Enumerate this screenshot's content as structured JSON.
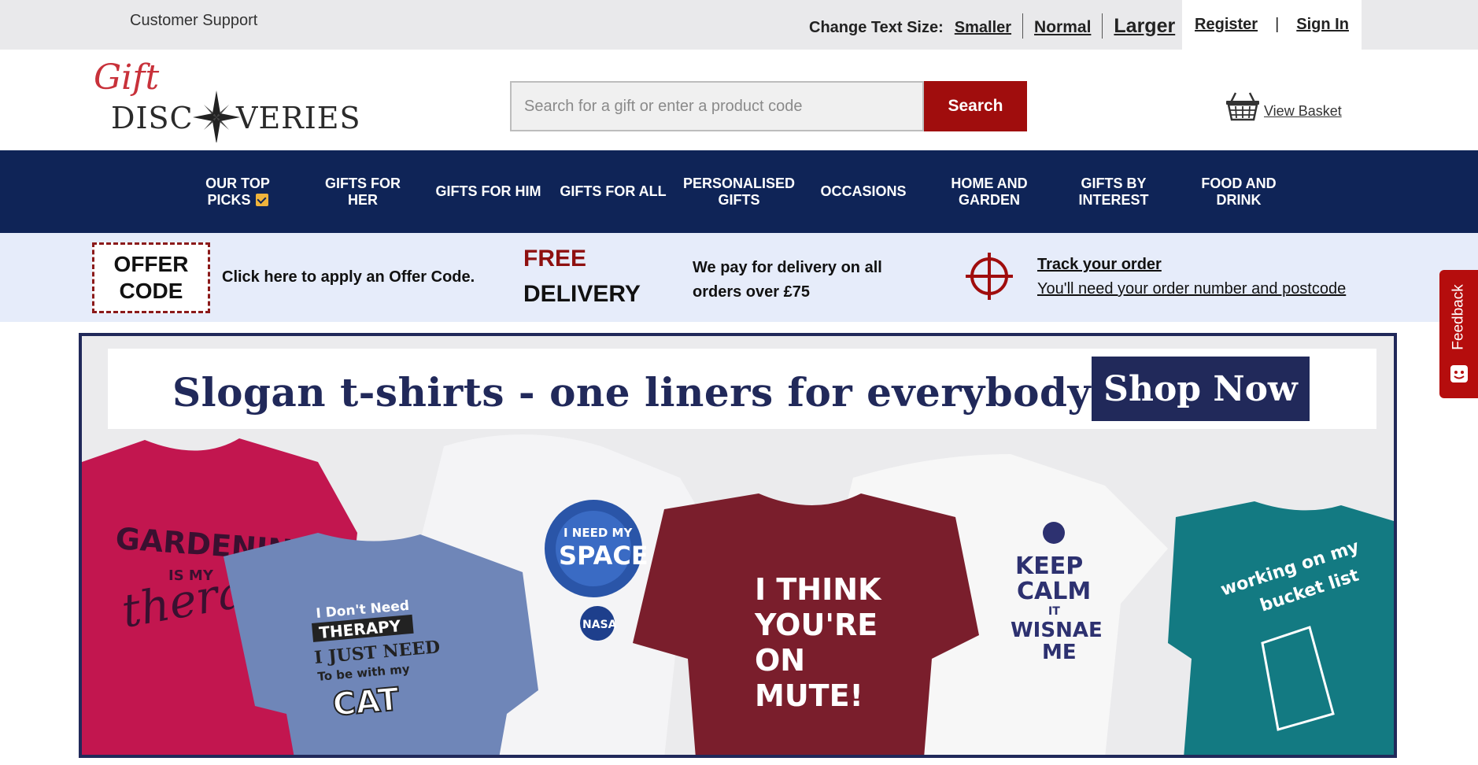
{
  "topbar": {
    "support": "Customer Support",
    "text_size_label": "Change Text Size:",
    "smaller": "Smaller",
    "normal": "Normal",
    "larger": "Larger",
    "register": "Register",
    "separator": "|",
    "sign_in": "Sign In"
  },
  "header": {
    "logo_top": "Gift",
    "logo_bottom_left": "DISC",
    "logo_bottom_right": "VERIES",
    "search_placeholder": "Search for a gift or enter a product code",
    "search_button": "Search",
    "basket_label": "View Basket"
  },
  "nav": {
    "items": [
      {
        "line1": "OUR TOP",
        "line2": "PICKS"
      },
      {
        "line1": "GIFTS FOR",
        "line2": "HER"
      },
      {
        "line1": "GIFTS FOR HIM",
        "line2": ""
      },
      {
        "line1": "GIFTS FOR ALL",
        "line2": ""
      },
      {
        "line1": "PERSONALISED",
        "line2": "GIFTS"
      },
      {
        "line1": "OCCASIONS",
        "line2": ""
      },
      {
        "line1": "HOME AND",
        "line2": "GARDEN"
      },
      {
        "line1": "GIFTS BY",
        "line2": "INTEREST"
      },
      {
        "line1": "FOOD AND",
        "line2": "DRINK"
      }
    ]
  },
  "promo": {
    "offer_line1": "OFFER",
    "offer_line2": "CODE",
    "offer_text": "Click here to apply an Offer Code.",
    "free": "FREE",
    "delivery": "DELIVERY",
    "delivery_note": "We pay for delivery on all orders over £75",
    "track_title": "Track your order",
    "track_sub": "You'll need your order number and postcode"
  },
  "feedback": {
    "label": "Feedback"
  },
  "banner": {
    "slogan": "Slogan t-shirts - one liners for everybody!",
    "shop_now": "Shop Now",
    "shirts": [
      {
        "text": [
          "GARDENING",
          "IS MY",
          "therapy"
        ],
        "color": "#c2164f"
      },
      {
        "text": [
          "I Don't Need",
          "THERAPY",
          "I JUST NEED",
          "To be with my",
          "CAT"
        ],
        "color": "#6f86b8"
      },
      {
        "text": [
          "I NEED MY",
          "SPACE",
          "NASA"
        ],
        "color": "#f4f4f6"
      },
      {
        "text": [
          "I THINK",
          "YOU'RE",
          "ON",
          "MUTE!"
        ],
        "color": "#7a1e2c"
      },
      {
        "text": [
          "KEEP",
          "CALM",
          "IT",
          "WISNAE",
          "ME"
        ],
        "color": "#f7f7f7"
      },
      {
        "text": [
          "working on my",
          "bucket list"
        ],
        "color": "#137a82"
      }
    ]
  },
  "colors": {
    "navy": "#0f2457",
    "brand_red": "#a00d0d",
    "promo_bg": "#e6ecfa",
    "banner_navy": "#21295a"
  }
}
